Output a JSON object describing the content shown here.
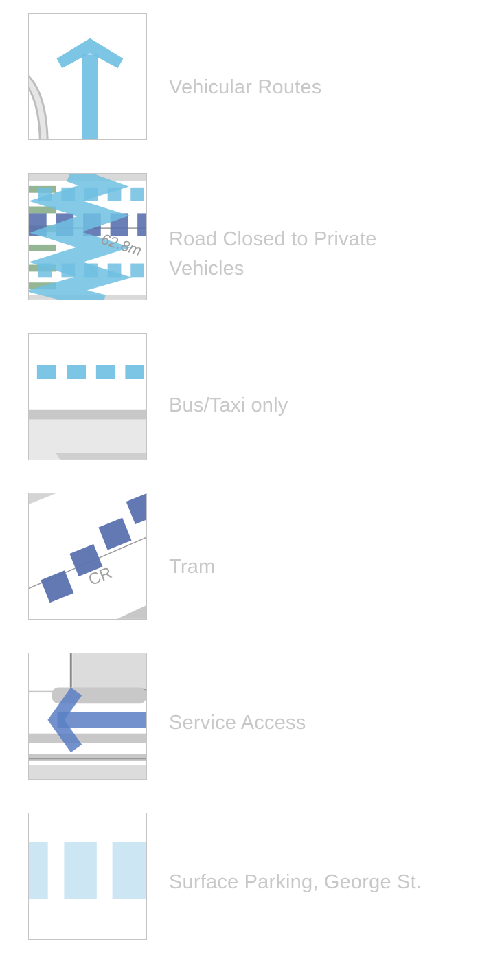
{
  "legend": {
    "items": [
      {
        "icon": "vehicular-routes-arrow-icon",
        "label": "Vehicular Routes",
        "color": "#6fbfe2"
      },
      {
        "icon": "road-closed-icon",
        "label_line1": "Road Closed to Private",
        "label_line2": "Vehicles",
        "overlay_text": "62.8m"
      },
      {
        "icon": "bus-taxi-dashed-line-icon",
        "label": "Bus/Taxi only",
        "color": "#6fbfe2"
      },
      {
        "icon": "tram-squares-icon",
        "label": "Tram",
        "overlay_text": "CR",
        "color": "#5b72b0"
      },
      {
        "icon": "service-access-arrow-icon",
        "label": "Service Access",
        "color": "#5b7fc4"
      },
      {
        "icon": "surface-parking-icon",
        "label": "Surface Parking, George St.",
        "color": "#cde6f3"
      }
    ],
    "label_color": "#c8c8c8",
    "border_color": "#c4c4c4"
  }
}
